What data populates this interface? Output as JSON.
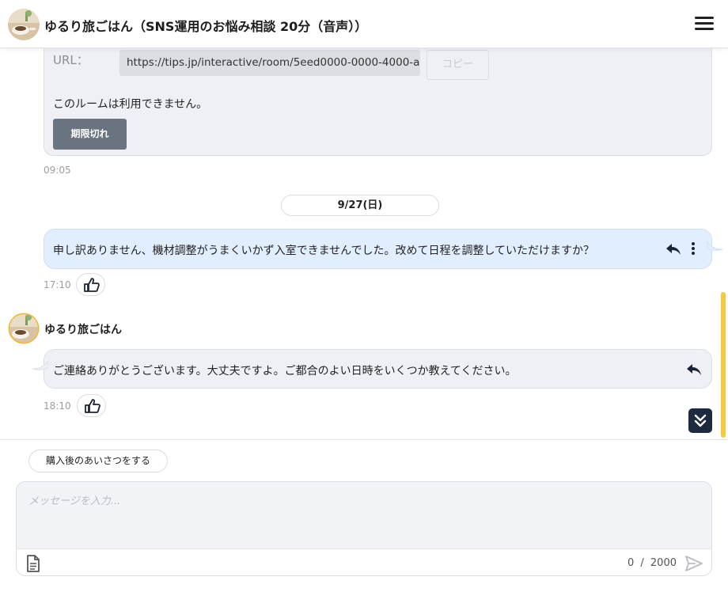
{
  "header": {
    "title": "ゆるり旅ごはん（SNS運用のお悩み相談 20分（音声））"
  },
  "room_card": {
    "url_label": "URL：",
    "url_value": "https://tips.jp/interactive/room/5eed0000-0000-4000-a",
    "copy_label": "コピー",
    "status_text": "このルームは利用できません。",
    "expired_label": "期限切れ",
    "time": "09:05"
  },
  "date_separator": "9/27(日)",
  "own_message": {
    "text": "申し訳ありません、機材調整がうまくいかず入室できませんでした。改めて日程を調整していただけますか？",
    "time": "17:10"
  },
  "other_message": {
    "sender": "ゆるり旅ごはん",
    "text": "ご連絡ありがとうございます。大丈夫ですよ。ご都合のよい日時をいくつか教えてください。",
    "time": "18:10"
  },
  "composer": {
    "greeting_button": "購入後のあいさつをする",
    "placeholder": "メッセージを入力...",
    "char_count": "0",
    "separator": "/",
    "char_max": "2000"
  },
  "colors": {
    "own_bubble": "#e1eefd",
    "other_bubble": "#eef0f5",
    "scroll_accent": "#f7c93a",
    "scroll_button": "#1d2a3f",
    "expired_button": "#6a7481"
  }
}
